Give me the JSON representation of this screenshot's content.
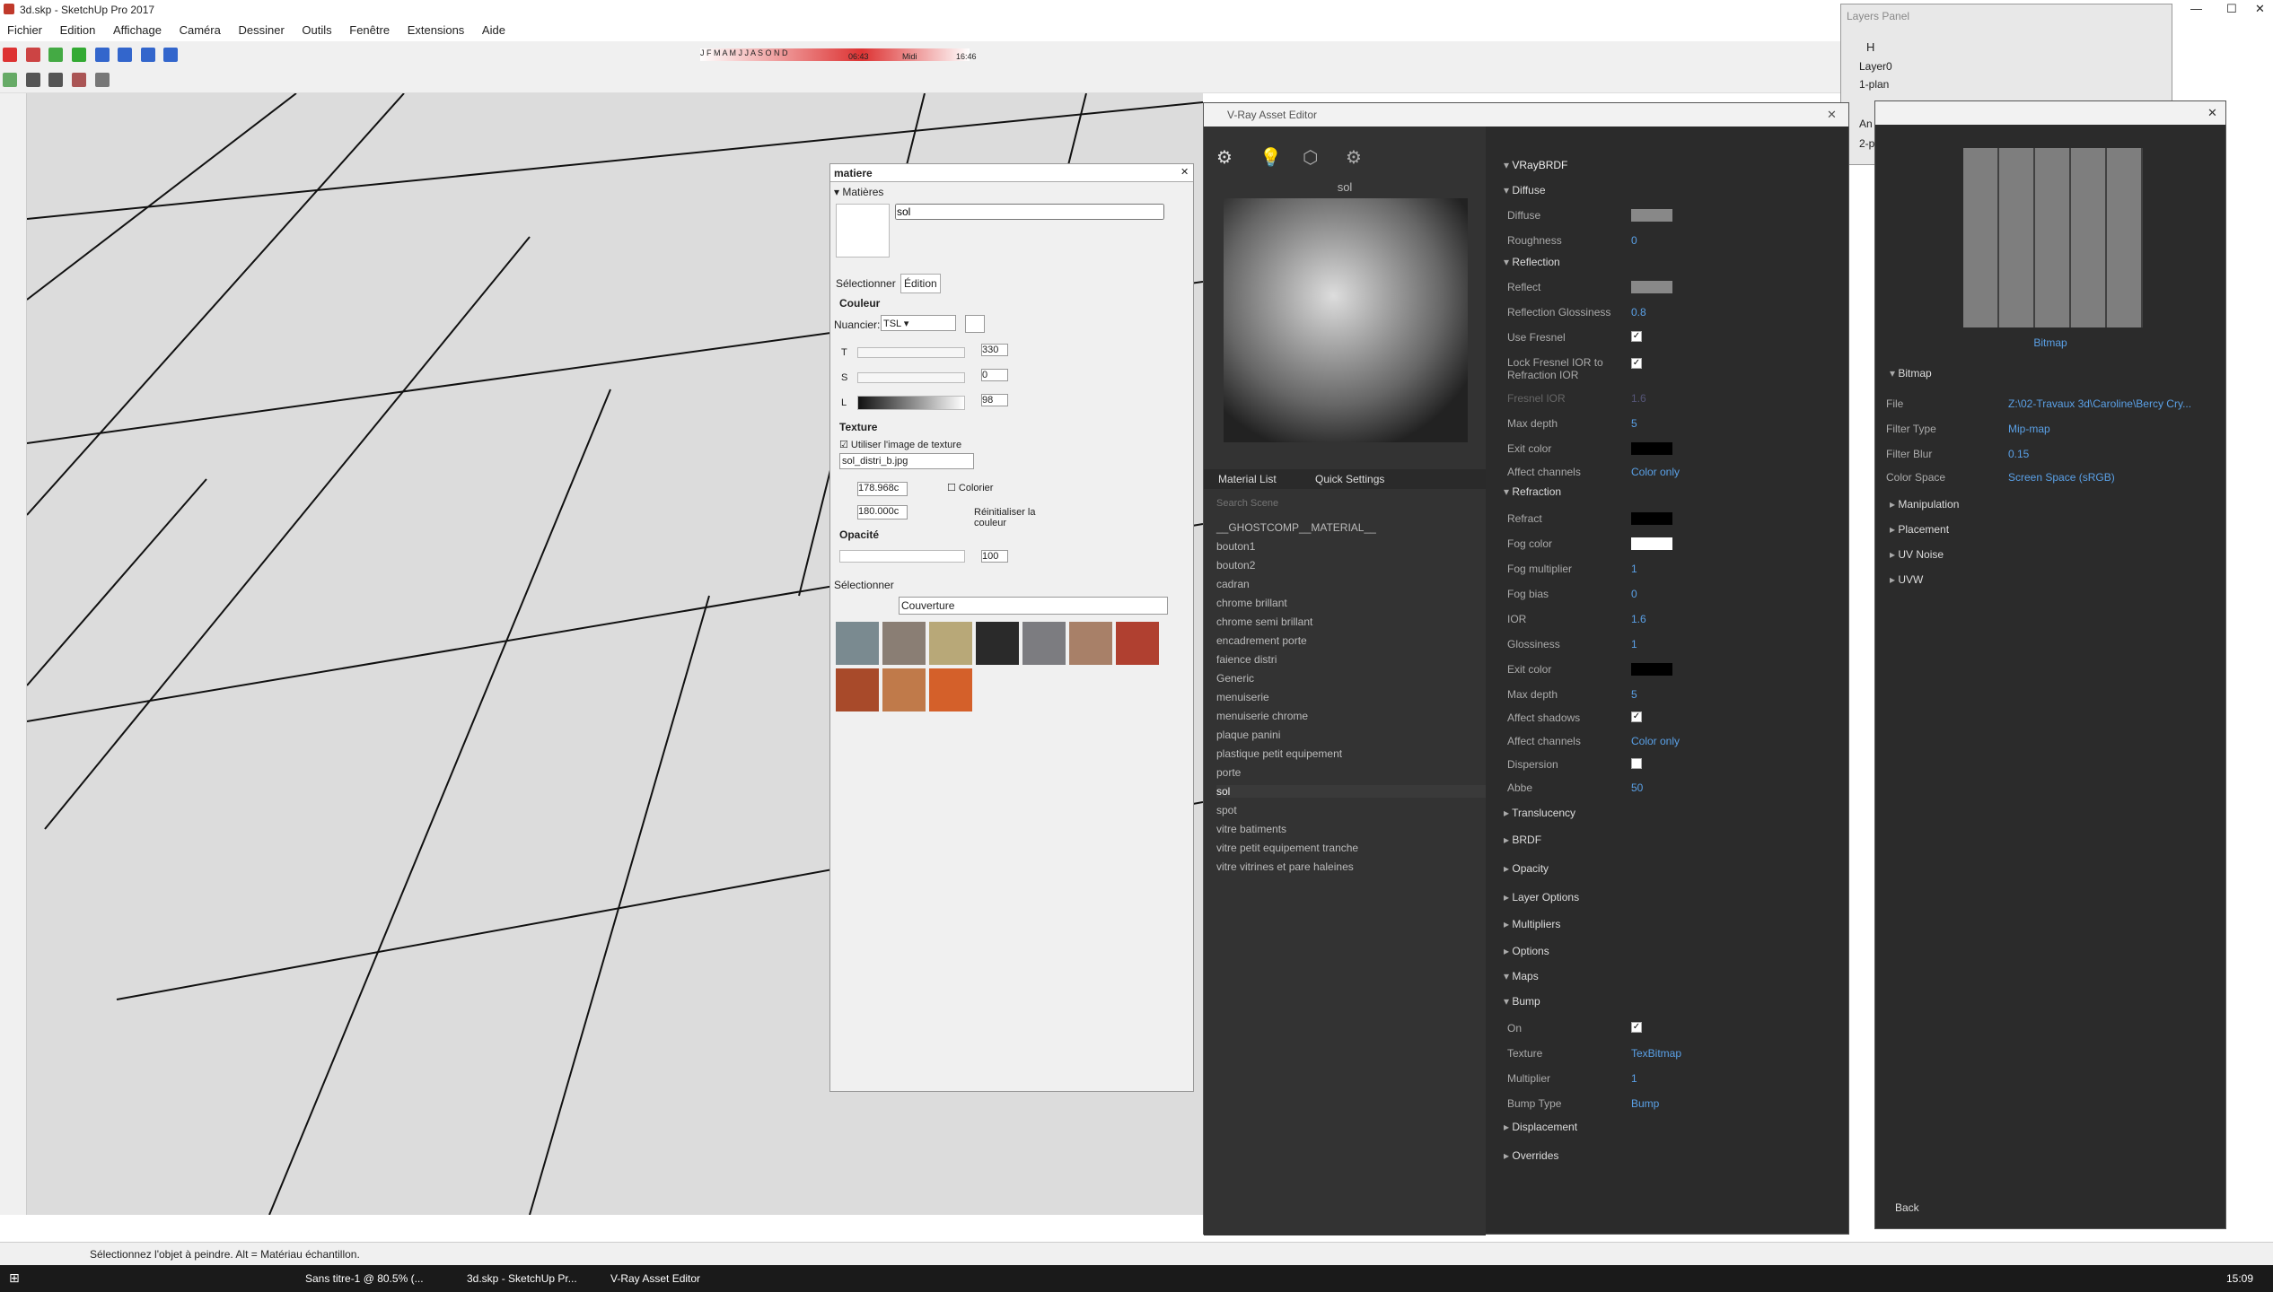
{
  "window": {
    "title": "3d.skp - SketchUp Pro 2017"
  },
  "menu": [
    "Fichier",
    "Edition",
    "Affichage",
    "Caméra",
    "Dessiner",
    "Outils",
    "Fenêtre",
    "Extensions",
    "Aide"
  ],
  "shadow": {
    "months": "J F M A M J J A S O N D",
    "time_start": "06:43",
    "time_mid": "Midi",
    "time_end": "16:46"
  },
  "layers": {
    "title": "Layers Panel",
    "header": "H",
    "items": [
      "Layer0",
      "1-plan",
      "An",
      "2-p"
    ]
  },
  "matiere": {
    "title": "matiere",
    "section": "Matières",
    "name": "sol",
    "tabs": [
      "Sélectionner",
      "Édition"
    ],
    "couleur": "Couleur",
    "nuancier_label": "Nuancier:",
    "nuancier": "TSL",
    "t_label": "T",
    "t": "330",
    "s_label": "S",
    "s": "0",
    "l_label": "L",
    "l": "98",
    "texture": "Texture",
    "use_texture": "Utiliser l'image de texture",
    "texture_file": "sol_distri_b.jpg",
    "width": "178.968c",
    "height": "180.000c",
    "colorier": "Colorier",
    "reset": "Réinitialiser la couleur",
    "opacite": "Opacité",
    "opacite_val": "100",
    "select_title": "Sélectionner",
    "library": "Couverture"
  },
  "vray": {
    "title": "V-Ray Asset Editor",
    "preview_name": "sol",
    "tabs": [
      "Material List",
      "Quick Settings"
    ],
    "search_placeholder": "Search Scene",
    "materials": [
      "__GHOSTCOMP__MATERIAL__",
      "bouton1",
      "bouton2",
      "cadran",
      "chrome brillant",
      "chrome semi brillant",
      "encadrement porte",
      "faience distri",
      "Generic",
      "menuiserie",
      "menuiserie chrome",
      "plaque panini",
      "plastique petit equipement",
      "porte",
      "sol",
      "spot",
      "vitre batiments",
      "vitre petit equipement tranche",
      "vitre vitrines et pare haleines"
    ],
    "brdf_header": "VRayBRDF",
    "diffuse": {
      "section": "Diffuse",
      "diffuse": "Diffuse",
      "roughness": "Roughness",
      "roughness_val": "0"
    },
    "reflection": {
      "section": "Reflection",
      "reflect": "Reflect",
      "gloss": "Reflection Glossiness",
      "gloss_val": "0.8",
      "fresnel": "Use Fresnel",
      "lock": "Lock Fresnel IOR to Refraction IOR",
      "fior": "Fresnel IOR",
      "fior_val": "1.6",
      "depth": "Max depth",
      "depth_val": "5",
      "exit": "Exit color",
      "affect": "Affect channels",
      "affect_val": "Color only"
    },
    "refraction": {
      "section": "Refraction",
      "refract": "Refract",
      "fog": "Fog color",
      "fogm": "Fog multiplier",
      "fogm_val": "1",
      "fogb": "Fog bias",
      "fogb_val": "0",
      "ior": "IOR",
      "ior_val": "1.6",
      "gloss": "Glossiness",
      "gloss_val": "1",
      "exit": "Exit color",
      "depth": "Max depth",
      "depth_val": "5",
      "shadows": "Affect shadows",
      "affect": "Affect channels",
      "affect_val": "Color only",
      "disp": "Dispersion",
      "abbe": "Abbe",
      "abbe_val": "50"
    },
    "collapsed": [
      "Translucency",
      "BRDF",
      "Opacity",
      "Layer Options",
      "Multipliers",
      "Options",
      "Maps"
    ],
    "bump": {
      "section": "Bump",
      "on": "On",
      "texture": "Texture",
      "texture_val": "TexBitmap",
      "mult": "Multiplier",
      "mult_val": "1",
      "type": "Bump Type",
      "type_val": "Bump"
    },
    "tail": [
      "Displacement",
      "Overrides"
    ]
  },
  "bitmap": {
    "title": "Bitmap",
    "section": "Bitmap",
    "file": "File",
    "file_val": "Z:\\02-Travaux 3d\\Caroline\\Bercy Cry...",
    "filter": "Filter Type",
    "filter_val": "Mip-map",
    "blur": "Filter Blur",
    "blur_val": "0.15",
    "cspace": "Color Space",
    "cspace_val": "Screen Space (sRGB)",
    "subs": [
      "Manipulation",
      "Placement",
      "UV Noise",
      "UVW"
    ],
    "back": "Back"
  },
  "status": {
    "text": "Sélectionnez l'objet à peindre. Alt = Matériau échantillon."
  },
  "taskbar": {
    "items": [
      "Sans titre-1 @ 80.5% (...",
      "3d.skp - SketchUp Pr...",
      "V-Ray Asset Editor"
    ],
    "time": "15:09"
  }
}
